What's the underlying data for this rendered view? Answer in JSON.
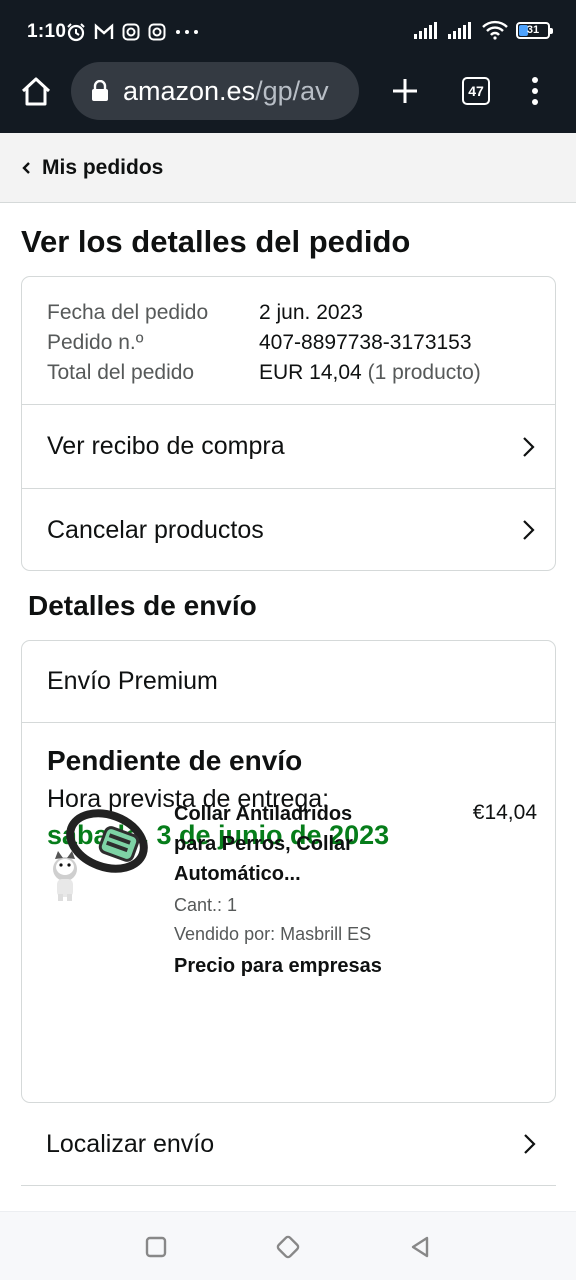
{
  "status_bar": {
    "time": "1:10",
    "battery": "31",
    "left_icons": [
      "alarm-icon",
      "gmail-icon",
      "instagram-icon",
      "instagram-icon",
      "more-dots-icon"
    ],
    "right_icons": [
      "signal-icon",
      "signal-icon",
      "wifi-icon",
      "battery-icon"
    ]
  },
  "browser": {
    "url_host": "amazon.es",
    "url_path": "/gp/av",
    "tab_count": "47"
  },
  "breadcrumb": {
    "label": "Mis pedidos"
  },
  "page": {
    "title": "Ver los detalles del pedido"
  },
  "order_summary": {
    "rows": [
      {
        "key": "Fecha del pedido",
        "value": "2 jun. 2023"
      },
      {
        "key": "Pedido n.º",
        "value": "407-8897738-3173153"
      },
      {
        "key": "Total del pedido",
        "value": "EUR 14,04",
        "extra": "(1 producto)"
      }
    ],
    "links": [
      "Ver recibo de compra",
      "Cancelar productos"
    ]
  },
  "shipping": {
    "section_title": "Detalles de envío",
    "method": "Envío Premium",
    "status": "Pendiente de envío",
    "eta_label": "Hora prevista de entrega:",
    "eta": "sábado, 3 de junio de 2023",
    "product": {
      "title_line1": "Collar Antiladridos",
      "title_line2": "para Perros, Collar",
      "title_line3": "Automático...",
      "qty": "Cant.: 1",
      "seller": "Vendido por: Masbrill ES",
      "business": "Precio para empresas",
      "price": "€14,04"
    },
    "track_label": "Localizar envío"
  },
  "colors": {
    "header_bg": "#131a22",
    "eta_green": "#067d1a",
    "border": "#d5d9d9"
  }
}
